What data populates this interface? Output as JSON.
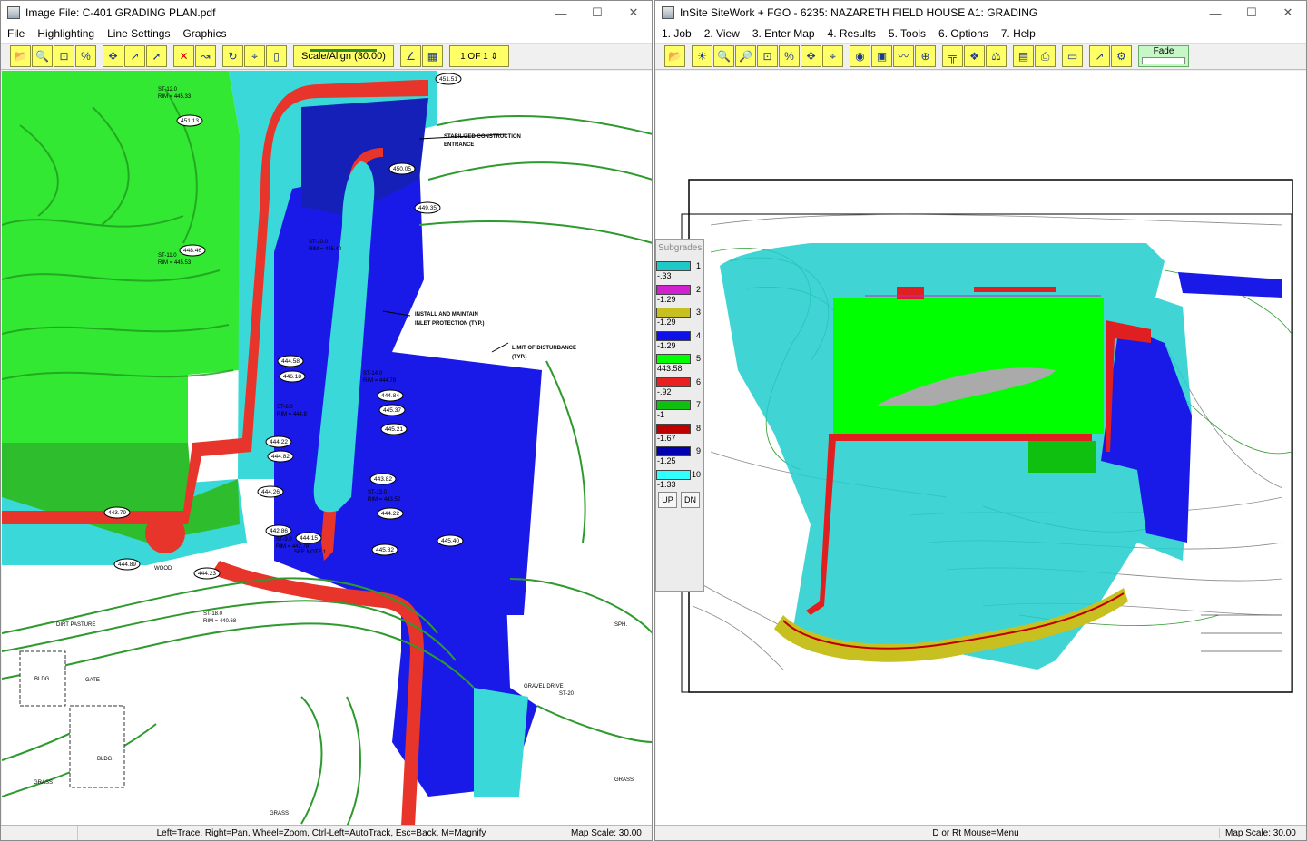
{
  "left_window": {
    "title": "Image File: C-401 GRADING PLAN.pdf",
    "menu": [
      "File",
      "Highlighting",
      "Line Settings",
      "Graphics"
    ],
    "toolbar": {
      "scale_align_label": "Scale/Align (30.00)",
      "page_indicator": "1 OF 1"
    },
    "plan_labels": {
      "stabilized_entrance": [
        "STABILIZED CONSTRUCTION",
        "ENTRANCE"
      ],
      "inlet_protection": [
        "INSTALL AND MAINTAIN",
        "INLET PROTECTION (TYP.)"
      ],
      "limit_disturbance": [
        "LIMIT OF DISTURBANCE",
        "(TYP.)"
      ],
      "spot_elevations": [
        "451.51",
        "451.13",
        "450.05",
        "449.35",
        "448.46",
        "444.58",
        "446.18",
        "444.84",
        "445.37",
        "445.21",
        "444.22",
        "444.82",
        "444.26",
        "443.82",
        "444.22",
        "442.86",
        "444.15",
        "445.82",
        "445.40",
        "444.89",
        "444.23",
        "443.79"
      ],
      "structures": [
        "ST-12.0",
        "RIM = 445.33",
        "ST-11.0",
        "RIM = 445.53",
        "ST-10.0",
        "RIM = 445.40",
        "ST-14.0",
        "RIM = 444.78",
        "ST-8.0",
        "RIM = 444.8",
        "ST-13.0",
        "RIM = 443.52",
        "ST-9.0",
        "RIM = 442.78",
        "ST-18.0",
        "RIM = 440.68"
      ],
      "misc": [
        "DIRT PASTURE",
        "GATE",
        "BLDG.",
        "BLDG.",
        "GRASS",
        "GRASS",
        "GRASS",
        "GRAVEL DRIVE",
        "WOOD",
        "SEE NOTE 1",
        "ST-20",
        "SPH."
      ]
    },
    "status": {
      "hint": "Left=Trace, Right=Pan, Wheel=Zoom, Ctrl-Left=AutoTrack, Esc=Back, M=Magnify",
      "scale": "Map Scale: 30.00"
    }
  },
  "right_window": {
    "title": "InSite SiteWork + FGO - 6235: NAZARETH FIELD HOUSE  A1: GRADING",
    "menu": [
      "1. Job",
      "2. View",
      "3. Enter Map",
      "4. Results",
      "5. Tools",
      "6. Options",
      "7. Help"
    ],
    "toolbar": {
      "fade_label": "Fade"
    },
    "subgrades": {
      "header": "Subgrades",
      "items": [
        {
          "num": "1",
          "value": "-.33",
          "color": "#20c8c8"
        },
        {
          "num": "2",
          "value": "-1.29",
          "color": "#d020d0"
        },
        {
          "num": "3",
          "value": "-1.29",
          "color": "#c8c020"
        },
        {
          "num": "4",
          "value": "-1.29",
          "color": "#1010e8"
        },
        {
          "num": "5",
          "value": "443.58",
          "color": "#00ff00"
        },
        {
          "num": "6",
          "value": "-.92",
          "color": "#e82020"
        },
        {
          "num": "7",
          "value": "-1",
          "color": "#10c010"
        },
        {
          "num": "8",
          "value": "-1.67",
          "color": "#c00000"
        },
        {
          "num": "9",
          "value": "-1.25",
          "color": "#0000b0"
        },
        {
          "num": "10",
          "value": "-1.33",
          "color": "#30ffff"
        }
      ],
      "up_label": "UP",
      "dn_label": "DN"
    },
    "status": {
      "hint": "D or Rt Mouse=Menu",
      "scale": "Map Scale: 30.00"
    }
  }
}
